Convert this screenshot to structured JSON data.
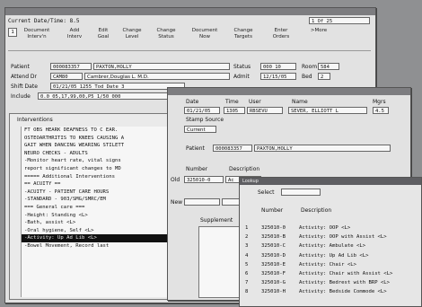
{
  "main": {
    "title": "",
    "current_label": "Current Date/Time: 8.5",
    "record_info": "1  Of  25",
    "tab1": "1",
    "toolbar": [
      {
        "id": "document-intervention",
        "label": "Document\nInterv'n"
      },
      {
        "id": "add-intervention",
        "label": "Add\nInterv"
      },
      {
        "id": "edit-goal",
        "label": "Edit\nGoal"
      },
      {
        "id": "change-level",
        "label": "Change\nLevel"
      },
      {
        "id": "change-status",
        "label": "Change\nStatus"
      },
      {
        "id": "document-now",
        "label": "Document\nNow"
      },
      {
        "id": "change-targets",
        "label": "Change\nTargets"
      },
      {
        "id": "enter-orders",
        "label": "Enter\nOrders"
      },
      {
        "id": "more",
        "label": ">More"
      }
    ],
    "patient_label": "Patient",
    "patient_id": "000083357",
    "patient_name": "PAXTON,HOLLY",
    "attend_label": "Attend Dr",
    "attend_code": "CAM80",
    "attend_name": "Cambrer,Douglas L. M.D.",
    "shift_label": "Shift Date",
    "shift_value": "01/21/05  1255  Tod Date  3",
    "include_label": "Include",
    "include_value": "0.0  05,17,99,00,P5 1/50  000",
    "status_label": "Status",
    "status_value": "000 10",
    "room_label": "Room",
    "room_value": "584",
    "admit_label": "Admit",
    "admit_value": "12/15/05",
    "bed_label": "Bed",
    "bed_value": "2",
    "interventions_header": "Interventions",
    "interventions": [
      "FT OBS HEARK DEAFNESS TO C EAR.",
      "OSTEOARTHRITIS TO KNEES CAUSING A",
      "GAIT WHEN DANCING WEARING STILETT",
      "NEURO CHECKS - ADULTS",
      "-Monitor heart rate, vital signs",
      "  report significant changes to MD",
      "===== Additional Interventions",
      "== ACUITY ==",
      "-ACUITY - PATIENT CARE HOURS",
      "-STANDARD - 903/SMG/SMRC/EM",
      "=== General care ===",
      "-Height: Standing <L>",
      "-Bath, assist <L>",
      "-Oral hygiene, Self <L>",
      "-Activity: Up Ad Lib <L>",
      "-Bowel Movement, Record last"
    ]
  },
  "charge": {
    "title": "",
    "date_label": "Date",
    "time_label": "Time",
    "user_label": "User",
    "name_label": "Name",
    "mgrs_label": "Mgrs",
    "date_value": "01/21/05",
    "time_value": "1305",
    "user_value": "RBSEVU",
    "name_value": "SEVER, ELLIOTT L",
    "mgrs_value": "4.5",
    "stamp_label": "Stamp Source",
    "stamp_value": "Current",
    "patient_label": "Patient",
    "patient_id": "000083357",
    "patient_name": "PAXTON,HOLLY",
    "number_label": "Number",
    "description_label": "Description",
    "old_label": "Old",
    "old_number": "325010-0",
    "old_desc": "Ac",
    "new_label": "New",
    "supplement_label": "Supplement"
  },
  "select": {
    "title": "Lookup",
    "select_label": "Select",
    "number_header": "Number",
    "description_header": "Description",
    "rows": [
      {
        "n": "1",
        "num": "325010-0",
        "desc": "Activity: OOP <L>"
      },
      {
        "n": "2",
        "num": "325010-B",
        "desc": "Activity: OOP with Assist <L>"
      },
      {
        "n": "3",
        "num": "325010-C",
        "desc": "Activity: Ambulate <L>"
      },
      {
        "n": "4",
        "num": "325010-D",
        "desc": "Activity: Up Ad Lib <L>"
      },
      {
        "n": "5",
        "num": "325010-E",
        "desc": "Activity: Chair <L>"
      },
      {
        "n": "6",
        "num": "325010-F",
        "desc": "Activity: Chair with Assist <L>"
      },
      {
        "n": "7",
        "num": "325010-G",
        "desc": "Activity: Bedrest with BRP <L>"
      },
      {
        "n": "8",
        "num": "325010-H",
        "desc": "Activity: Bedside Commode <L>"
      }
    ]
  },
  "colors": {
    "desktop": "#8f9092",
    "window": "#e2e2e2",
    "titlebar": "#7d7d80",
    "field": "#f7f7f7",
    "selection": "#111111"
  }
}
